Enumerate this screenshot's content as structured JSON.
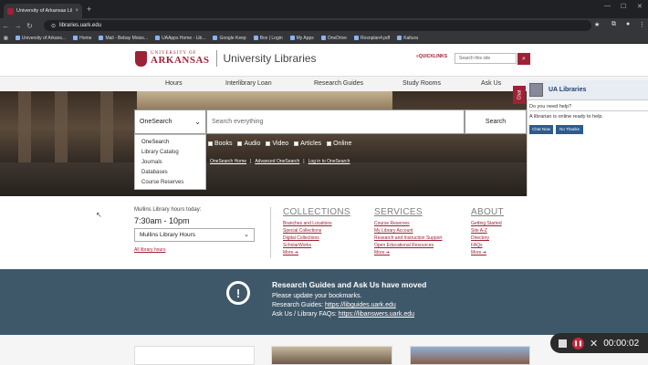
{
  "browser": {
    "tab_title": "University of Arkansas Libraries",
    "tab_close": "×",
    "new_tab": "+",
    "window_controls": [
      "—",
      "☐",
      "✕"
    ],
    "url": "libraries.uark.edu",
    "bookmarks": [
      "University of Arkans...",
      "Home",
      "Mail - Bebay Moiso...",
      "UAApps Home - Lib...",
      "Google Keep",
      "Box | Login",
      "My Apps",
      "OneDrive",
      "Rosnplan4.pdf",
      "Kaltura"
    ]
  },
  "header": {
    "logo_small": "UNIVERSITY OF",
    "logo_big": "ARKANSAS",
    "library_name": "University Libraries",
    "quicklinks": "≡QUICKLINKS",
    "search_placeholder": "Search this site"
  },
  "nav": [
    "Hours",
    "Interlibrary Loan",
    "Research Guides",
    "Study Rooms",
    "Ask Us"
  ],
  "onesearch": {
    "selected": "OneSearch",
    "placeholder": "Search everything",
    "search_button": "Search",
    "options": [
      "OneSearch",
      "Library Catalog",
      "Journals",
      "Databases",
      "Course Reserves"
    ],
    "filters": [
      "Books",
      "Audio",
      "Video",
      "Articles",
      "Online"
    ],
    "links": [
      "OneSearch Home",
      "Advanced OneSearch",
      "Log in to OneSearch"
    ],
    "link_sep": "|"
  },
  "chat": {
    "tab": "Chat",
    "title": "UA Libraries",
    "question": "Do you need help?",
    "message": "A librarian is online ready to help.",
    "buttons": [
      "Chat Now",
      "No Thanks"
    ]
  },
  "hours": {
    "label": "Mullins Library hours today:",
    "time": "7:30am - 10pm",
    "selected_library": "Mullins Library Hours",
    "all_hours": "All library hours"
  },
  "columns": [
    {
      "heading": "COLLECTIONS",
      "links": [
        "Branches and Locations",
        "Special Collections",
        "Digital Collections",
        "ScholarWorks",
        "More ➔"
      ]
    },
    {
      "heading": "SERVICES",
      "links": [
        "Course Reserves",
        "My Library Account",
        "Research and Instruction Support",
        "Open Educational Resources",
        "More ➔"
      ]
    },
    {
      "heading": "ABOUT",
      "links": [
        "Getting Started",
        "Site A-Z",
        "Directory",
        "FAQs",
        "More ➔"
      ]
    }
  ],
  "banner": {
    "icon": "!",
    "title": "Research Guides and Ask Us have moved",
    "line1": "Please update your bookmarks.",
    "line2_label": "Research Guides: ",
    "line2_link": "https://libguides.uark.edu",
    "line3_label": "Ask Us / Library FAQs: ",
    "line3_link": "https://libanswers.uark.edu"
  },
  "recorder": {
    "time": "00:00:02",
    "pause_glyph": "❚❚",
    "close_glyph": "✕"
  },
  "colors": {
    "brand": "#9d2235",
    "banner": "#3f5869",
    "chat_button": "#2d5b8e"
  }
}
